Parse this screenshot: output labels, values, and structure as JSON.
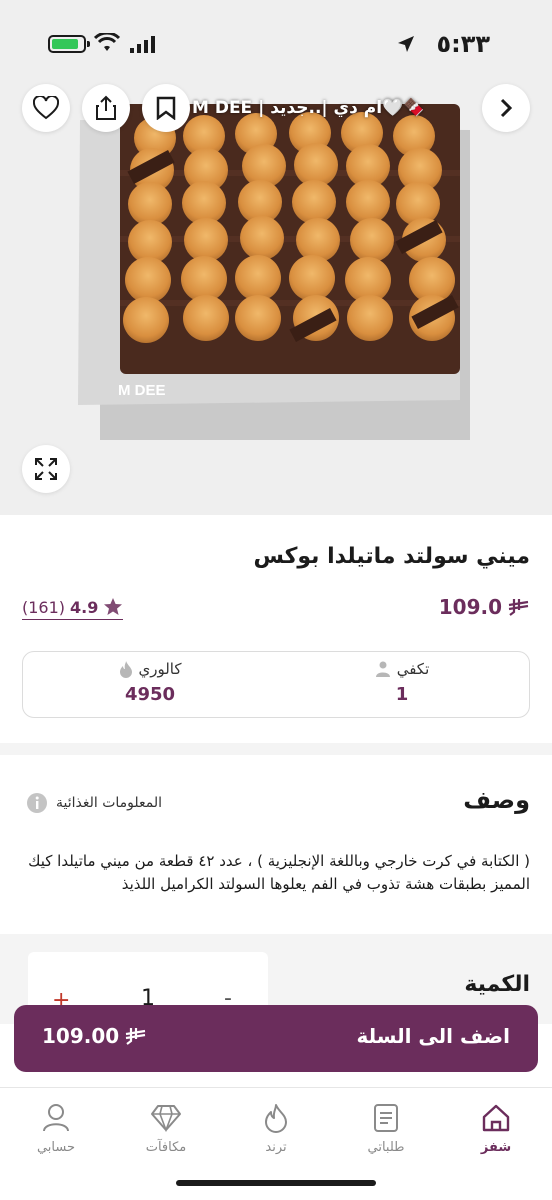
{
  "status_bar": {
    "time": "٥:٣٣"
  },
  "header": {
    "product_title": "🍫🤍ام دي |..جديد | M DEE",
    "back_icon": "chevron-right-icon",
    "bookmark_icon": "bookmark-icon",
    "share_icon": "share-icon",
    "favorite_icon": "heart-icon"
  },
  "hero": {
    "brand_text": "M DEE"
  },
  "product": {
    "name": "ميني سولتد ماتيلدا بوكس",
    "price": "109.0",
    "rating": "4.9",
    "rating_count": "(161)",
    "serves_label": "تكفي",
    "serves_value": "1",
    "calories_label": "كالوري",
    "calories_value": "4950"
  },
  "description": {
    "title": "وصف",
    "nutrition_link": "المعلومات الغذائية",
    "text": "( الكتابة في كرت خارجي وباللغة الإنجليزية ) ، عدد ٤٢ قطعة من ميني ماتيلدا كيك المميز بطبقات هشة تذوب في الفم يعلوها السولتد الكراميل اللذيذ"
  },
  "quantity": {
    "label": "الكمية",
    "value": "1",
    "minus": "-",
    "plus": "+"
  },
  "cart": {
    "label": "اضف الى السلة",
    "price": "109.00"
  },
  "nav": {
    "items": [
      {
        "label": "شفز",
        "icon": "home-icon"
      },
      {
        "label": "طلباتي",
        "icon": "orders-icon"
      },
      {
        "label": "ترند",
        "icon": "flame-icon"
      },
      {
        "label": "مكافآت",
        "icon": "diamond-icon"
      },
      {
        "label": "حسابي",
        "icon": "user-icon"
      }
    ]
  },
  "colors": {
    "accent": "#6b2d5c",
    "caramel": "#e0a25a",
    "chocolate": "#4a2a1e"
  }
}
